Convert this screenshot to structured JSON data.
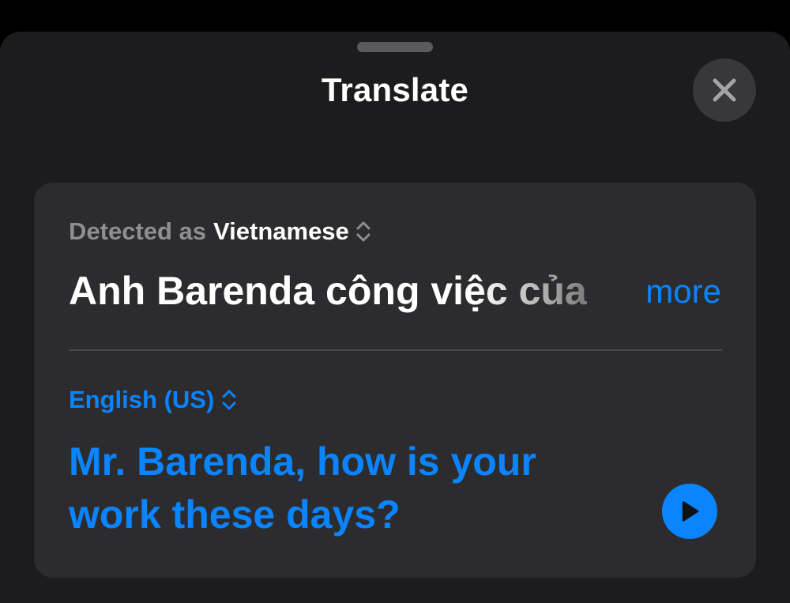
{
  "sheet": {
    "title": "Translate",
    "close_icon": "xmark-icon"
  },
  "source": {
    "detected_prefix": "Detected as",
    "language": "Vietnamese",
    "language_picker_icon": "chevron-up-down-icon",
    "text": "Anh Barenda công việc của",
    "more_label": "more"
  },
  "target": {
    "language": "English (US)",
    "language_picker_icon": "chevron-up-down-icon",
    "translation": "Mr. Barenda, how is your work these days?",
    "play_icon": "play-icon"
  },
  "colors": {
    "background": "#000000",
    "sheet": "#1c1c1e",
    "card": "#2c2c2e",
    "accent": "#0a84ff",
    "secondary_text": "#8e8e93"
  }
}
